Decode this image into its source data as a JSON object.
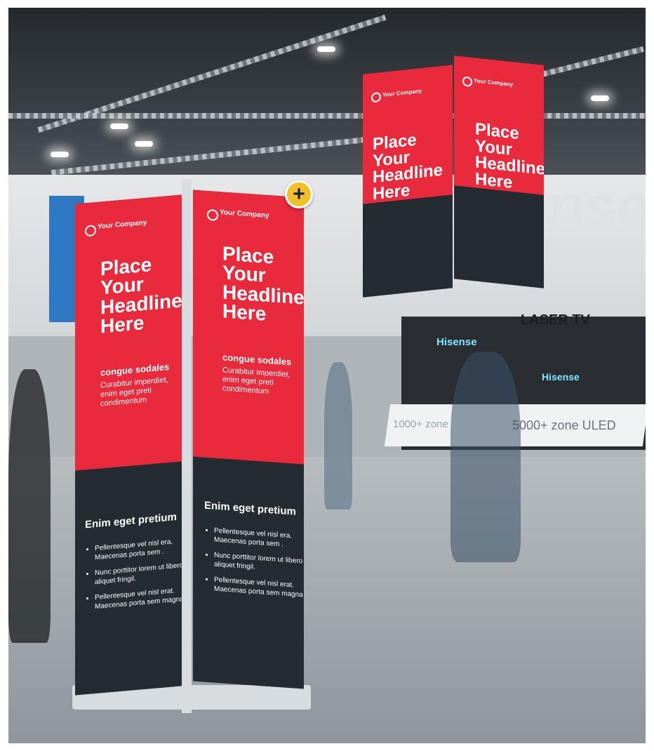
{
  "banner": {
    "company": "Your Company",
    "headline": [
      "Place",
      "Your",
      "Headline",
      "Here"
    ],
    "sub": "congue sodales",
    "body": [
      "Curabitur imperdiet,",
      "enim eget preti",
      "condimentum"
    ],
    "section_title": "Enim eget pretium",
    "bullets": [
      "Pellentesque vel nisl era. Maecenas porta sem .",
      "Nunc porttitor lorem ut libero aliquet fringil.",
      "Pellentesque vel nisl erat. Maecenas porta sem magna"
    ]
  },
  "hanging": {
    "company": "Your Company",
    "headline": [
      "Place Your",
      "Headline",
      "Here"
    ]
  },
  "background": {
    "brand": "Hisense",
    "wall_text": "nse",
    "counter_left": "1000+ zone",
    "counter_right": "5000+ zone ULED",
    "laser": "LASER TV"
  },
  "colors": {
    "accent_red": "#e82a3c",
    "panel_dark": "#242b31",
    "plus_yellow": "#f4c02a"
  },
  "add_button": {
    "label": "+"
  }
}
